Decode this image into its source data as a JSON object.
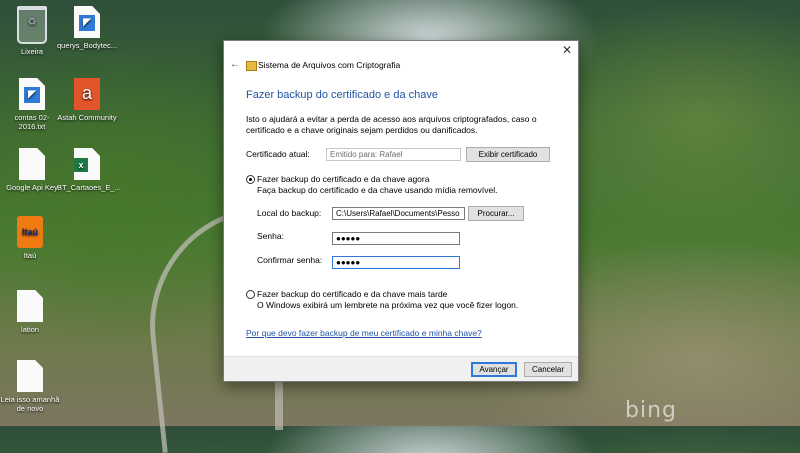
{
  "desktop": {
    "icons": [
      {
        "label": "Lixeira",
        "icon": "recycle-bin-icon"
      },
      {
        "label": "querys_Bodytec...",
        "icon": "vscode-file-icon"
      },
      {
        "label": "contas 02-2016.txt",
        "icon": "vscode-file-icon"
      },
      {
        "label": "Astah Community",
        "icon": "astah-icon"
      },
      {
        "label": "Google Api Key",
        "icon": "blank-file-icon"
      },
      {
        "label": "BT_Cartaoes_E_...",
        "icon": "excel-file-icon"
      },
      {
        "label": "Itaú",
        "icon": "itau-shortcut-icon"
      },
      {
        "label": "lation",
        "icon": "blank-file-icon"
      },
      {
        "label": "Leia isso amanhã de novo",
        "icon": "blank-file-icon"
      }
    ],
    "watermark": "bing"
  },
  "dialog": {
    "title": "Sistema de Arquivos com Criptografia",
    "heading": "Fazer backup do certificado e da chave",
    "intro": "Isto o ajudará a evitar a perda de acesso aos arquivos criptografados, caso o certificado e a chave originais sejam perdidos ou danificados.",
    "cert_label": "Certificado atual:",
    "cert_value": "Emitido para: Rafael",
    "view_cert_button": "Exibir certificado",
    "option_now": {
      "label": "Fazer backup do certificado e da chave agora",
      "desc": "Faça backup do certificado e da chave usando mídia removível.",
      "checked": true
    },
    "backup_location_label": "Local do backup:",
    "backup_location_value": "C:\\Users\\Rafael\\Documents\\Pesso",
    "browse_button": "Procurar...",
    "password_label": "Senha:",
    "password_value": "●●●●●",
    "confirm_label": "Confirmar senha:",
    "confirm_value": "●●●●●",
    "option_later": {
      "label": "Fazer backup do certificado e da chave mais tarde",
      "desc": "O Windows exibirá um lembrete na próxima vez que você fizer logon.",
      "checked": false
    },
    "help_link": "Por que devo fazer backup de meu certificado e minha chave?",
    "next_button": "Avançar",
    "cancel_button": "Cancelar",
    "close_glyph": "✕",
    "back_glyph": "←"
  }
}
